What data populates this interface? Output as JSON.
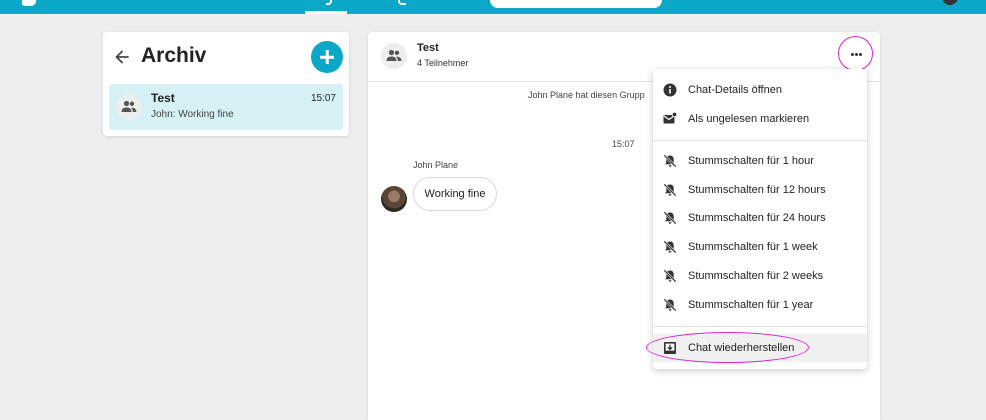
{
  "icons": {
    "back": "arrow-left-icon",
    "add": "plus-icon",
    "group": "people-icon",
    "more": "more-horizontal-icon",
    "info": "info-icon",
    "mark_unread": "mail-badge-icon",
    "mute": "bell-off-icon",
    "restore": "unarchive-icon"
  },
  "colors": {
    "accent": "#0aa7c6",
    "selected_chat": "#d6f1f6",
    "annotation": "#e21fd3"
  },
  "sidebar": {
    "title": "Archiv",
    "chats": [
      {
        "name": "Test",
        "time": "15:07",
        "preview": "John: Working fine"
      }
    ]
  },
  "chat": {
    "name": "Test",
    "members": "4 Teilnehmer",
    "system_message": "John Plane hat diesen Grupp",
    "message_time": "15:07",
    "sender": "John Plane",
    "message_text": "Working fine"
  },
  "menu": {
    "details": "Chat-Details öffnen",
    "mark_unread": "Als ungelesen markieren",
    "mute_options": [
      "Stummschalten für 1 hour",
      "Stummschalten für 12 hours",
      "Stummschalten für 24 hours",
      "Stummschalten für 1 week",
      "Stummschalten für 2 weeks",
      "Stummschalten für 1 year"
    ],
    "restore": "Chat wiederherstellen"
  }
}
